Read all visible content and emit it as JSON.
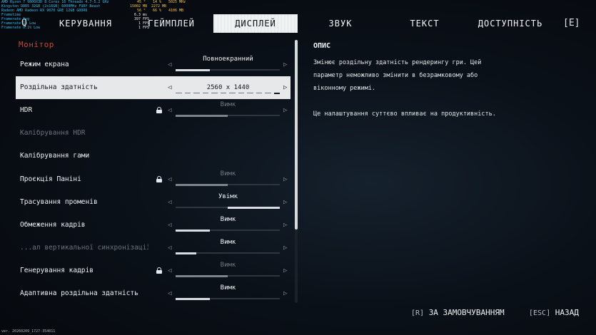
{
  "overlay": {
    "lines": [
      {
        "label": "AMD Ryzen 7 9800X3D 8 Cores 16 Threads 4.7-5.2 GHz",
        "values": [
          "45 °",
          "14 %",
          "5025 MHz",
          "38.2 W"
        ]
      },
      {
        "label": "Kingston DDR5 32GB (2x16GB) 6000MHz FURY Beast",
        "values": [
          "15002 MB",
          "2272 MB"
        ]
      },
      {
        "label": "Radeon AMD Radeon RX 9070 GRE 12GB GDDR6",
        "values": [
          "56 °",
          "66 %",
          "4106 MB",
          "2702 MHz",
          "2474 MHz",
          "2230 MHz",
          "219.0 W"
        ]
      }
    ],
    "stats": [
      {
        "label": "Frametime",
        "value": "6.3 ms"
      },
      {
        "label": "Framerate Avg",
        "value": "397 FPS"
      },
      {
        "label": "Framerate 1% Low",
        "value": "1 FPS"
      },
      {
        "label": "Framerate 0.1% Low",
        "value": "1 FPS"
      }
    ]
  },
  "tabs": {
    "q_key": "Q",
    "e_key": "[E]",
    "items": [
      "КЕРУВАННЯ",
      "ГЕЙМПЛЕЙ",
      "ДИСПЛЕЙ",
      "ЗВУК",
      "ТЕКСТ",
      "ДОСТУПНІСТЬ"
    ],
    "active": "ДИСПЛЕЙ"
  },
  "section": "Монітор",
  "settings": [
    {
      "label": "Режим екрана",
      "value": "Повноекранний",
      "fill": 0.33
    },
    {
      "label": "Роздільна здатність",
      "value": "2560 x 1440",
      "selected": true,
      "segments": 12,
      "active_segment": 12
    },
    {
      "label": "HDR",
      "value": "Вимк",
      "locked": true,
      "dim": true,
      "fill": 0.5
    },
    {
      "label": "Калібрування HDR",
      "disabled": true
    },
    {
      "label": "Калібрування гами"
    },
    {
      "label": "Проєкція Паніні",
      "value": "Вимк",
      "locked": true,
      "dim": true,
      "fill": 0.5
    },
    {
      "label": "Трасування променів",
      "value": "Увімк",
      "fill_start": 0.5,
      "fill": 0.5
    },
    {
      "label": "Обмеження кадрів",
      "value": "Вимк",
      "fill": 0.33
    },
    {
      "label": "...ал вертикальної синхронізації",
      "value": "Вимк",
      "disabled": true,
      "fill": 0.2
    },
    {
      "label": "Генерування кадрів",
      "value": "Вимк",
      "locked": true,
      "dim": true,
      "fill": 0.5
    },
    {
      "label": "Адаптивна роздільна здатність",
      "value": "Вимк",
      "fill": 0.33
    }
  ],
  "description": {
    "title": "ОПИС",
    "p1": "Змінює роздільну здатність рендерингу гри. Цей",
    "p2": "параметр неможливо змінити в безрамковому або",
    "p3": "віконному режимі.",
    "p4": "Це налаштування суттєво впливає на продуктивність."
  },
  "footer": {
    "default_key": "[R]",
    "default_label": "ЗА ЗАМОВЧУВАННЯМ",
    "back_key": "[ESC]",
    "back_label": "НАЗАД"
  },
  "version": "ver. 20260209_1727-354011",
  "colors": {
    "accent": "#c24a3c",
    "overlay_cyan": "#3fb8e6",
    "overlay_yellow": "#f0c44a",
    "selected_bg": "#e6e8ea"
  }
}
